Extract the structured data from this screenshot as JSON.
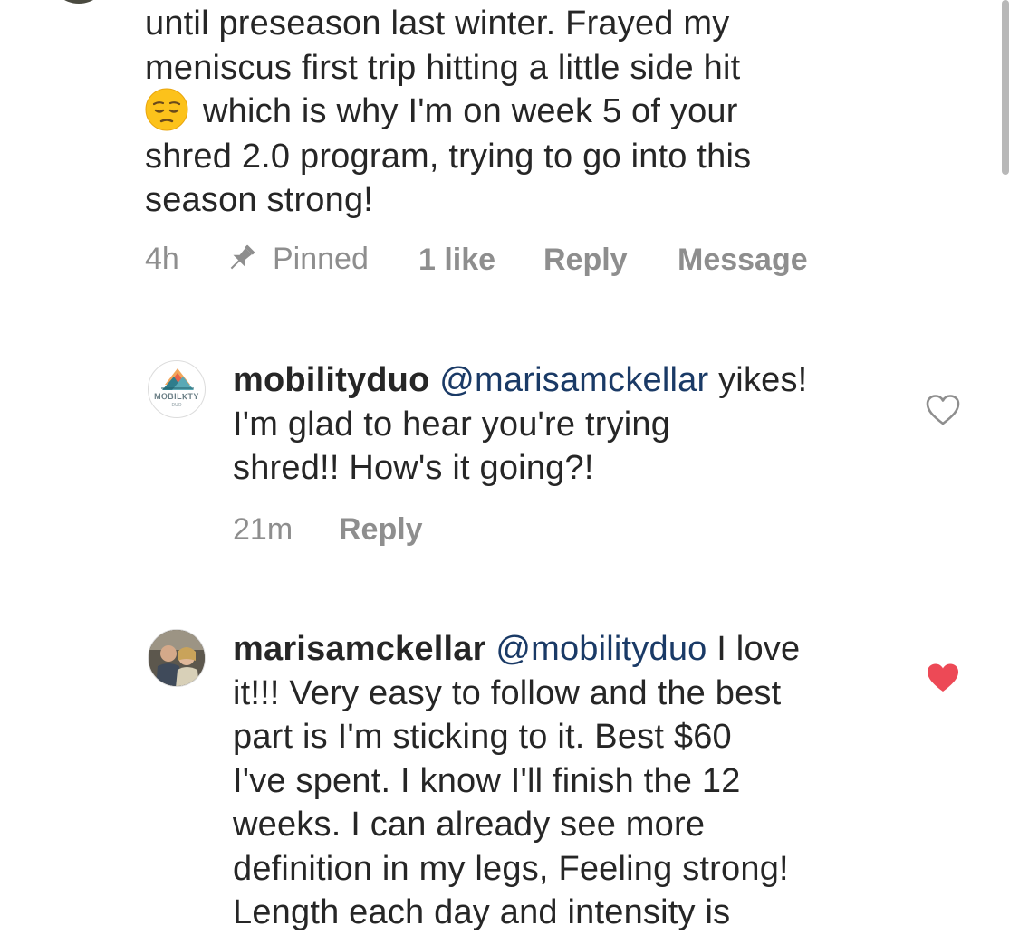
{
  "comment1": {
    "lines": [
      "until preseason last winter. Frayed my",
      "meniscus first trip hitting a little side hit",
      "which is why I'm on week 5 of your",
      "shred 2.0 program, trying to go into this",
      "season strong!"
    ],
    "emoji": "pensive-face-emoji",
    "meta": {
      "time": "4h",
      "pinned_label": "Pinned",
      "likes": "1 like",
      "reply": "Reply",
      "message": "Message"
    }
  },
  "reply1": {
    "username": "mobilityduo",
    "mention": "@marisamckellar",
    "lines": [
      "yikes!",
      "I'm glad to hear you're trying",
      "shred!! How's it going?!"
    ],
    "avatar_text": "MⲞBILⲔTY",
    "avatar_subtext": "DUO",
    "meta": {
      "time": "21m",
      "reply": "Reply"
    },
    "liked": false
  },
  "reply2": {
    "username": "marisamckellar",
    "mention": "@mobilityduo",
    "lines": [
      "I love",
      "it!!! Very easy to follow and the best",
      "part is I'm sticking to it. Best $60",
      "I've spent. I know I'll finish the 12",
      "weeks. I can already see more",
      "definition in my legs, Feeling strong!",
      "Length each day and intensity is"
    ],
    "liked": true
  },
  "colors": {
    "text": "#262626",
    "secondary": "#8e8e8e",
    "mention": "#1a3a66",
    "heart_liked": "#ed4956",
    "heart_outline": "#8e8e8e"
  }
}
